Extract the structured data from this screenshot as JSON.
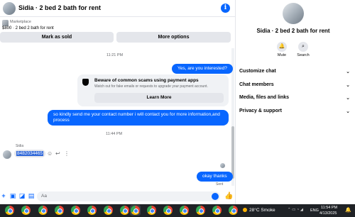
{
  "header": {
    "title": "Sidia · 2 bed 2 bath for rent"
  },
  "listing": {
    "tag": "Marketplace",
    "price_title": "$800 · 2 bed 2 bath for rent",
    "mark_sold_label": "Mark as sold",
    "more_options_label": "More options"
  },
  "messages": {
    "time1": "11:21 PM",
    "out1": "Yes, are you interested?",
    "scam_title": "Beware of common scams using payment apps",
    "scam_sub": "Watch out for fake emails or requests to upgrade your payment account.",
    "learn_more": "Learn More",
    "out2_line1": "so kindly send me your contact number i will contact  you for more information,and",
    "out2_line2": "process",
    "time2": "11:44 PM",
    "sender": "Sidia",
    "in1": "8482034465",
    "out3": "okay thanks",
    "sent": "Sent"
  },
  "composer": {
    "placeholder": "Aa"
  },
  "details": {
    "title": "Sidia · 2 bed 2 bath for rent",
    "mute_label": "Mute",
    "search_label": "Search",
    "sections": [
      "Customize chat",
      "Chat members",
      "Media, files and links",
      "Privacy & support"
    ]
  },
  "taskbar": {
    "weather": "28°C  Smoke",
    "lang": "ENG",
    "time": "11:54 PM",
    "date": "4/13/2025"
  },
  "colors": {
    "accent": "#0866ff",
    "bubble_in": "#e4e6eb",
    "taskbar": "#1f2226"
  }
}
